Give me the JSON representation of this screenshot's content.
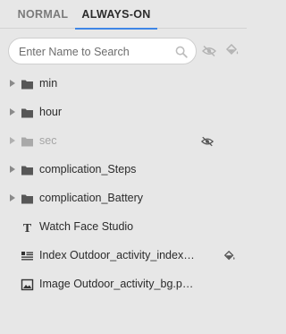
{
  "tabs": [
    {
      "label": "NORMAL",
      "active": false
    },
    {
      "label": "ALWAYS-ON",
      "active": true
    }
  ],
  "search": {
    "placeholder": "Enter Name to Search",
    "value": ""
  },
  "colors": {
    "accent": "#3f86e6",
    "background": "#e7e7e7"
  },
  "layers": [
    {
      "label": "min",
      "icon": "folder-icon",
      "expandable": true
    },
    {
      "label": "hour",
      "icon": "folder-icon",
      "expandable": true
    },
    {
      "label": "sec",
      "icon": "folder-icon",
      "expandable": true,
      "hidden": true,
      "indicator": "eye-hidden-icon"
    },
    {
      "label": "complication_Steps",
      "icon": "folder-icon",
      "expandable": true
    },
    {
      "label": "complication_Battery",
      "icon": "folder-icon",
      "expandable": true
    },
    {
      "label": "Watch Face Studio",
      "icon": "text-icon",
      "expandable": false
    },
    {
      "label": "Index Outdoor_activity_index…",
      "icon": "index-icon",
      "expandable": false,
      "indicator": "paint-bucket-icon"
    },
    {
      "label": "Image Outdoor_activity_bg.p…",
      "icon": "image-icon",
      "expandable": false
    }
  ]
}
